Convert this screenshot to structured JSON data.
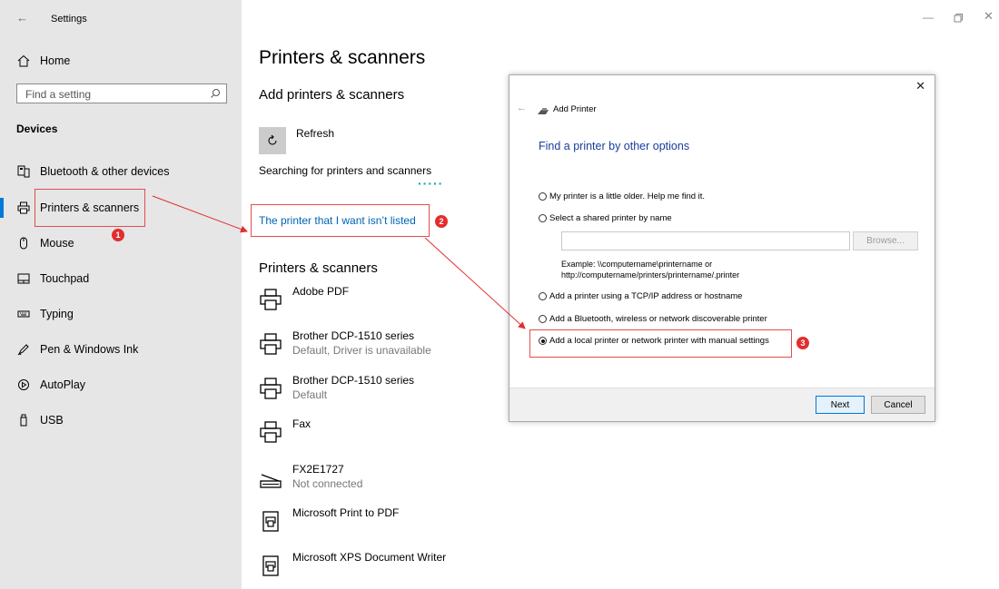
{
  "window": {
    "title": "Settings",
    "controls": [
      "minimize",
      "maximize",
      "close"
    ]
  },
  "sidebar": {
    "home_label": "Home",
    "search_placeholder": "Find a setting",
    "section_heading": "Devices",
    "items": [
      {
        "label": "Bluetooth & other devices",
        "icon": "bluetooth-devices-icon"
      },
      {
        "label": "Printers & scanners",
        "icon": "printer-icon",
        "selected": true
      },
      {
        "label": "Mouse",
        "icon": "mouse-icon"
      },
      {
        "label": "Touchpad",
        "icon": "touchpad-icon"
      },
      {
        "label": "Typing",
        "icon": "keyboard-icon"
      },
      {
        "label": "Pen & Windows Ink",
        "icon": "pen-icon"
      },
      {
        "label": "AutoPlay",
        "icon": "autoplay-icon"
      },
      {
        "label": "USB",
        "icon": "usb-icon"
      }
    ]
  },
  "main": {
    "title": "Printers & scanners",
    "add_heading": "Add printers & scanners",
    "refresh_label": "Refresh",
    "searching_text": "Searching for printers and scanners",
    "not_listed_link": "The printer that I want isn’t listed",
    "list_heading": "Printers & scanners",
    "printers": [
      {
        "name": "Adobe PDF",
        "status": "",
        "icon": "printer-icon"
      },
      {
        "name": "Brother DCP-1510 series",
        "status": "Default, Driver is unavailable",
        "icon": "printer-icon"
      },
      {
        "name": "Brother DCP-1510 series",
        "status": "Default",
        "icon": "printer-icon"
      },
      {
        "name": "Fax",
        "status": "",
        "icon": "printer-icon"
      },
      {
        "name": "FX2E1727",
        "status": "Not connected",
        "icon": "scanner-icon"
      },
      {
        "name": "Microsoft Print to PDF",
        "status": "",
        "icon": "pdf-printer-icon"
      },
      {
        "name": "Microsoft XPS Document Writer",
        "status": "",
        "icon": "pdf-printer-icon"
      }
    ]
  },
  "dialog": {
    "title": "Add Printer",
    "heading": "Find a printer by other options",
    "options": [
      {
        "label": "My printer is a little older. Help me find it.",
        "selected": false
      },
      {
        "label": "Select a shared printer by name",
        "selected": false
      },
      {
        "label": "Add a printer using a TCP/IP address or hostname",
        "selected": false
      },
      {
        "label": "Add a Bluetooth, wireless or network discoverable printer",
        "selected": false
      },
      {
        "label": "Add a local printer or network printer with manual settings",
        "selected": true
      }
    ],
    "shared_input_value": "",
    "browse_label": "Browse...",
    "example_line1": "Example: \\\\computername\\printername or",
    "example_line2": "http://computername/printers/printername/.printer",
    "next_label": "Next",
    "cancel_label": "Cancel"
  },
  "annotations": {
    "badge1": "1",
    "badge2": "2",
    "badge3": "3",
    "color": "#e32d2d"
  },
  "colors": {
    "accent": "#0078d7",
    "link": "#0063b1",
    "dialog_heading": "#1a3d9a",
    "sidebar_bg": "#e6e6e6"
  }
}
